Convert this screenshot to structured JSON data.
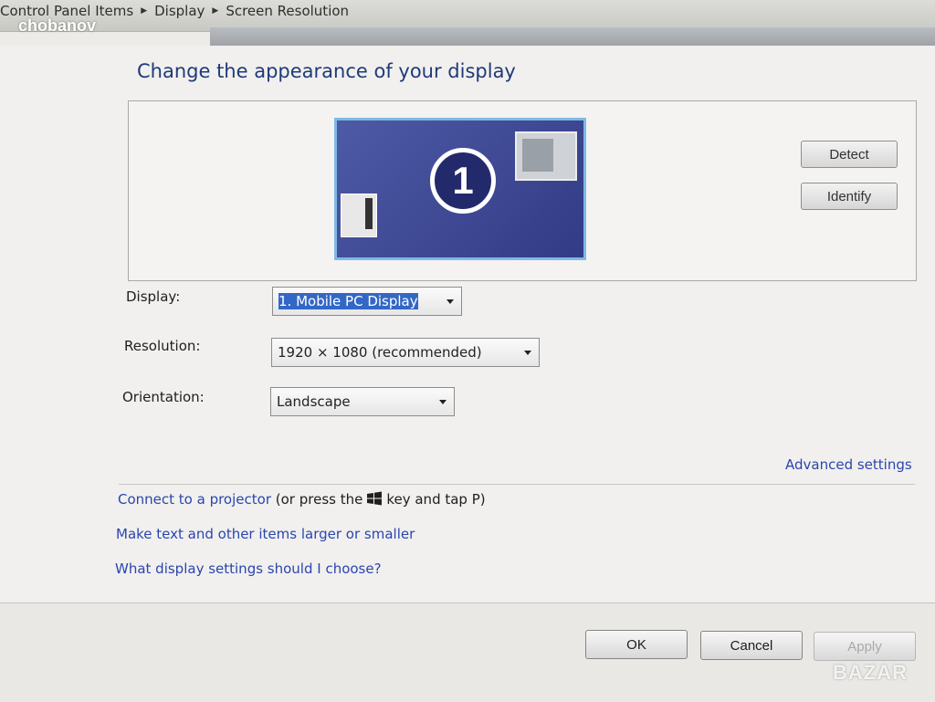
{
  "breadcrumb": {
    "items": [
      "Control Panel Items",
      "Display",
      "Screen Resolution"
    ]
  },
  "watermarks": {
    "top": "chobanov",
    "bottom": "BAZAR"
  },
  "page": {
    "title": "Change the appearance of your display"
  },
  "monitor": {
    "number": "1"
  },
  "buttons": {
    "detect": "Detect",
    "identify": "Identify"
  },
  "fields": {
    "display": {
      "label": "Display:",
      "value": "1. Mobile PC Display"
    },
    "resolution": {
      "label": "Resolution:",
      "value": "1920 × 1080 (recommended)"
    },
    "orientation": {
      "label": "Orientation:",
      "value": "Landscape"
    }
  },
  "links": {
    "advanced": "Advanced settings",
    "projector": "Connect to a projector",
    "projector_hint_before": "(or press the",
    "projector_hint_after": "key and tap P)",
    "text_size": "Make text and other items larger or smaller",
    "which_settings": "What display settings should I choose?"
  },
  "footer": {
    "ok": "OK",
    "cancel": "Cancel",
    "apply": "Apply"
  },
  "icons": {
    "breadcrumb_separator": "chevron-right-icon",
    "windows_key": "windows-logo-icon",
    "dropdown": "dropdown-arrow-icon"
  },
  "colors": {
    "title": "#1f3a7a",
    "link": "#2a45b0",
    "monitor_fill": "#3e478f",
    "monitor_border": "#7db9e6"
  }
}
